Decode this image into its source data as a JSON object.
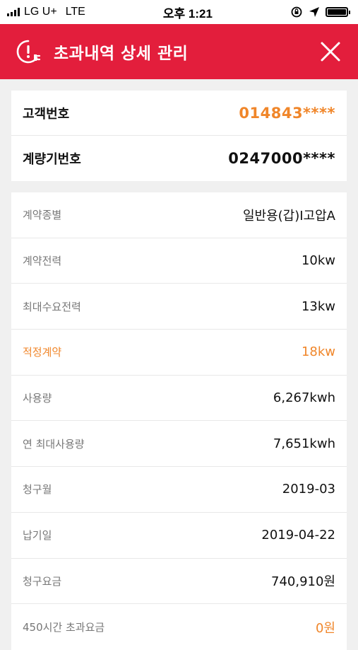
{
  "status_bar": {
    "carrier": "LG U+",
    "network": "LTE",
    "time": "오후 1:21"
  },
  "header": {
    "title": "초과내역 상세 관리",
    "bg_color": "#e31e3c"
  },
  "ids": {
    "customer_number_label": "고객번호",
    "customer_number_value": "014843****",
    "meter_number_label": "계량기번호",
    "meter_number_value": "0247000****"
  },
  "details": {
    "contract_type_label": "계약종별",
    "contract_type_value": "일반용(갑)I고압A",
    "contract_power_label": "계약전력",
    "contract_power_value": "10kw",
    "max_demand_label": "최대수요전력",
    "max_demand_value": "13kw",
    "optimal_contract_label": "적정계약",
    "optimal_contract_value": "18kw",
    "usage_label": "사용량",
    "usage_value": "6,267kwh",
    "annual_max_usage_label": "연 최대사용량",
    "annual_max_usage_value": "7,651kwh",
    "billing_month_label": "청구월",
    "billing_month_value": "2019-03",
    "due_date_label": "납기일",
    "due_date_value": "2019-04-22",
    "charge_label": "청구요금",
    "charge_value": "740,910원",
    "overtime_charge_label": "450시간 초과요금",
    "overtime_charge_value": "0원"
  },
  "accent_color": "#f0862a"
}
